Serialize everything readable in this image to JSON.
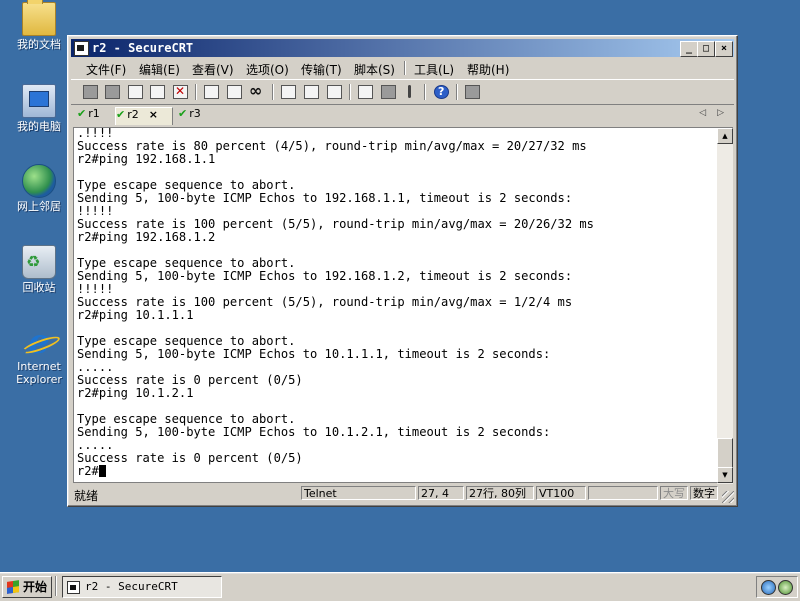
{
  "desktop": {
    "icons": [
      {
        "label": "我的文档",
        "icon": "my-documents-icon"
      },
      {
        "label": "我的电脑",
        "icon": "my-computer-icon"
      },
      {
        "label": "网上邻居",
        "icon": "network-places-icon"
      },
      {
        "label": "回收站",
        "icon": "recycle-bin-icon"
      },
      {
        "label": "Internet Explorer",
        "icon": "internet-explorer-icon"
      }
    ]
  },
  "window": {
    "title": "r2 - SecureCRT",
    "controls": {
      "minimize": "_",
      "maximize": "□",
      "close": "×"
    }
  },
  "menu": [
    "文件(F)",
    "编辑(E)",
    "查看(V)",
    "选项(O)",
    "传输(T)",
    "脚本(S)",
    "工具(L)",
    "帮助(H)"
  ],
  "tabs": [
    {
      "label": "r1",
      "status": "connected",
      "active": false
    },
    {
      "label": "r2",
      "status": "connected",
      "active": true,
      "close": "×"
    },
    {
      "label": "r3",
      "status": "connected",
      "active": false
    }
  ],
  "terminal": {
    "lines": [
      ".!!!!",
      "Success rate is 80 percent (4/5), round-trip min/avg/max = 20/27/32 ms",
      "r2#ping 192.168.1.1",
      "",
      "Type escape sequence to abort.",
      "Sending 5, 100-byte ICMP Echos to 192.168.1.1, timeout is 2 seconds:",
      "!!!!!",
      "Success rate is 100 percent (5/5), round-trip min/avg/max = 20/26/32 ms",
      "r2#ping 192.168.1.2",
      "",
      "Type escape sequence to abort.",
      "Sending 5, 100-byte ICMP Echos to 192.168.1.2, timeout is 2 seconds:",
      "!!!!!",
      "Success rate is 100 percent (5/5), round-trip min/avg/max = 1/2/4 ms",
      "r2#ping 10.1.1.1",
      "",
      "Type escape sequence to abort.",
      "Sending 5, 100-byte ICMP Echos to 10.1.1.1, timeout is 2 seconds:",
      ".....",
      "Success rate is 0 percent (0/5)",
      "r2#ping 10.1.2.1",
      "",
      "Type escape sequence to abort.",
      "Sending 5, 100-byte ICMP Echos to 10.1.2.1, timeout is 2 seconds:",
      ".....",
      "Success rate is 0 percent (0/5)"
    ],
    "prompt": "r2#"
  },
  "status": {
    "ready": "就绪",
    "protocol": "Telnet",
    "cursor_pos": "27,  4",
    "size": "27行, 80列",
    "emulation": "VT100",
    "blank": "",
    "caps": "大写",
    "num": "数字"
  },
  "taskbar": {
    "start_label": "开始",
    "task_label": "r2 - SecureCRT"
  }
}
